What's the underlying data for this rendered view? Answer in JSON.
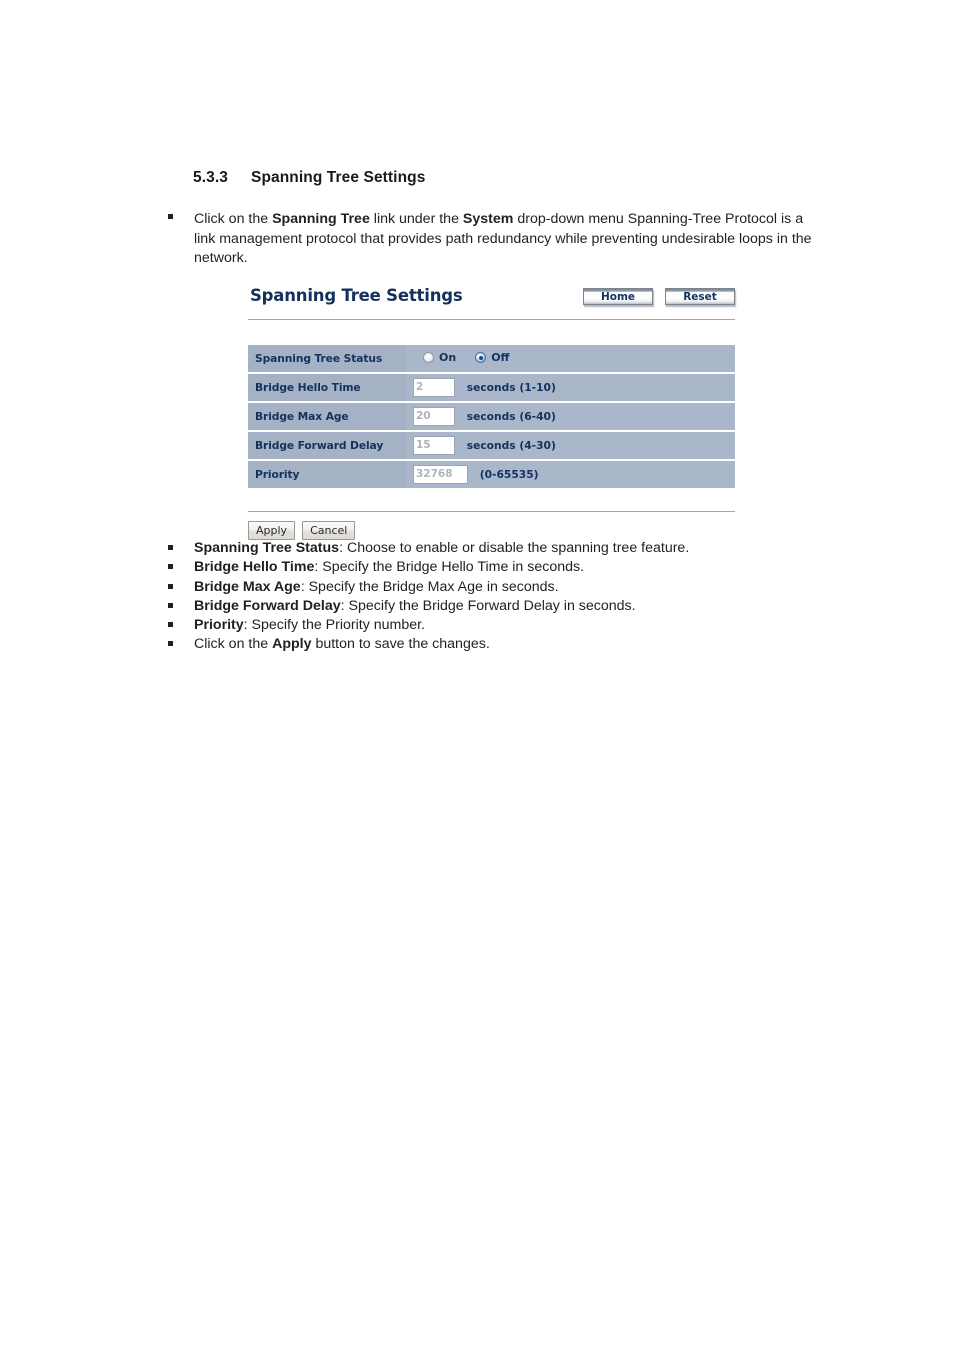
{
  "document": {
    "section_number": "5.3.3",
    "section_title": "Spanning Tree Settings",
    "intro": {
      "part1": "Click on the ",
      "bold1": "Spanning Tree",
      "part2": " link under the ",
      "bold2": "System",
      "part3": " drop-down menu Spanning-Tree Protocol is a link management protocol that provides path redundancy while preventing undesirable loops in the network."
    },
    "descriptions": [
      {
        "term": "Spanning Tree Status",
        "text": ": Choose to enable or disable the spanning tree feature."
      },
      {
        "term": "Bridge Hello Time",
        "text": ": Specify the Bridge Hello Time in seconds."
      },
      {
        "term": "Bridge Max Age",
        "text": ": Specify the Bridge Max Age in seconds."
      },
      {
        "term": "Bridge Forward Delay",
        "text": ": Specify the Bridge Forward Delay in seconds."
      },
      {
        "term": "Priority",
        "text": ": Specify the Priority number."
      }
    ],
    "final_bullet": {
      "pre": "Click on the ",
      "bold": "Apply",
      "post": " button to save the changes."
    }
  },
  "ui": {
    "title": "Spanning Tree Settings",
    "header_buttons": {
      "home": "Home",
      "reset": "Reset"
    },
    "rows": {
      "status": {
        "label": "Spanning Tree Status",
        "option_on": "On",
        "option_off": "Off",
        "selected": "Off"
      },
      "hello_time": {
        "label": "Bridge Hello Time",
        "value": "2",
        "suffix": "seconds (1-10)"
      },
      "max_age": {
        "label": "Bridge Max Age",
        "value": "20",
        "suffix": "seconds (6-40)"
      },
      "forward_delay": {
        "label": "Bridge Forward Delay",
        "value": "15",
        "suffix": "seconds (4-30)"
      },
      "priority": {
        "label": "Priority",
        "value": "32768",
        "suffix": "(0-65535)"
      }
    },
    "actions": {
      "apply": "Apply",
      "cancel": "Cancel"
    },
    "colors": {
      "title_navy": "#13315c",
      "label_cell_bg": "#a5b2c6",
      "value_cell_bg": "#aab7ca",
      "rule": "#9aa8bc",
      "radio_selected": "#1b4a86"
    }
  }
}
